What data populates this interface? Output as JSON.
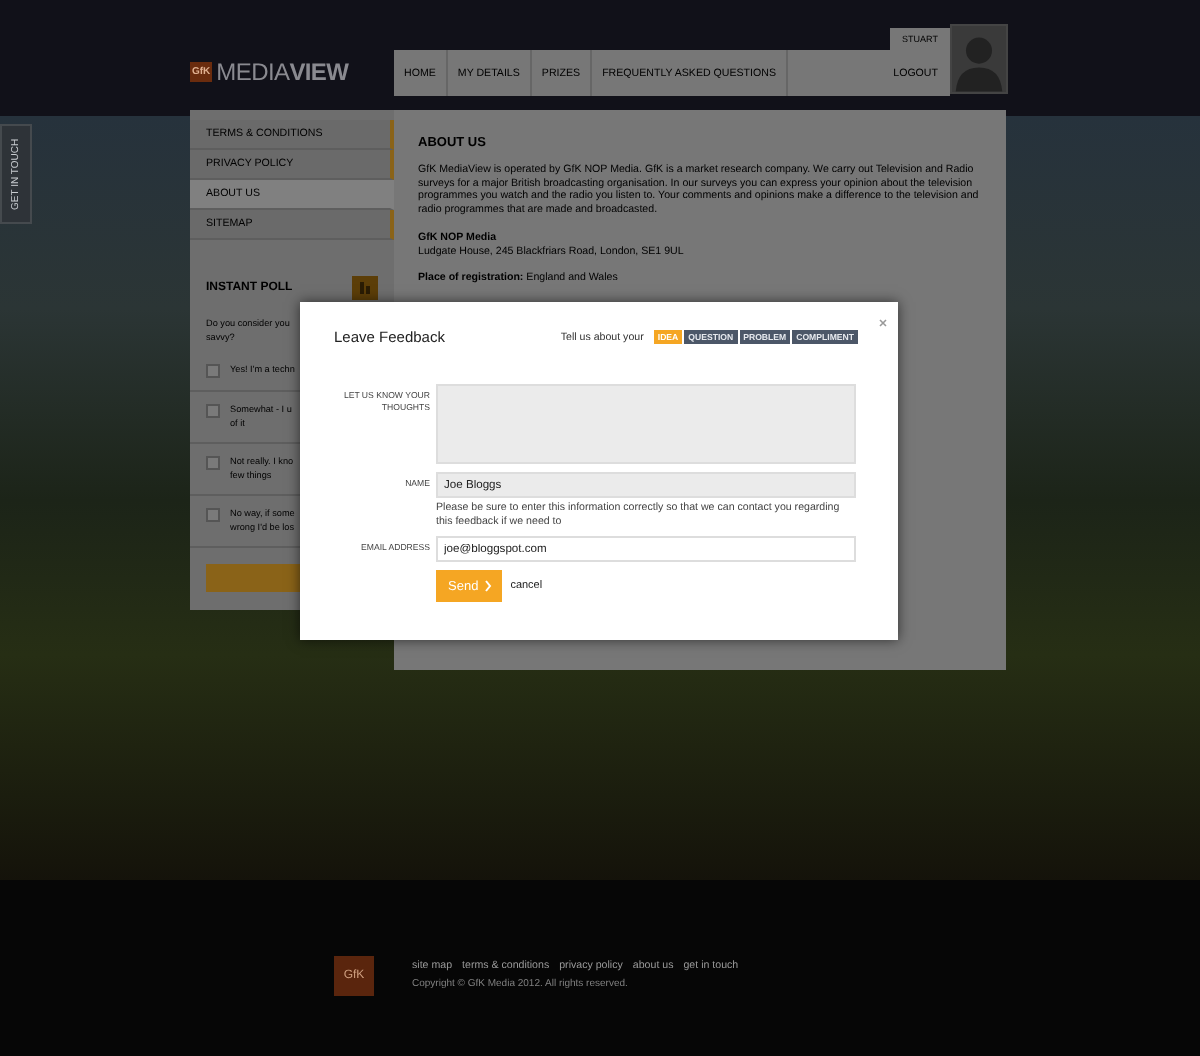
{
  "header": {
    "logo": {
      "mark": "GfK",
      "name_light": "MEDIA",
      "name_bold": "VIEW"
    },
    "nav": [
      {
        "label": "HOME"
      },
      {
        "label": "MY DETAILS"
      },
      {
        "label": "PRIZES"
      },
      {
        "label": "FREQUENTLY ASKED QUESTIONS"
      }
    ],
    "logout": "LOGOUT",
    "user": {
      "name": "STUART"
    }
  },
  "side_tab": {
    "label": "GET IN TOUCH"
  },
  "sidebar": {
    "items": [
      {
        "label": "TERMS & CONDITIONS",
        "selected": false
      },
      {
        "label": "PRIVACY POLICY",
        "selected": false
      },
      {
        "label": "ABOUT US",
        "selected": true
      },
      {
        "label": "SITEMAP",
        "selected": false
      }
    ],
    "poll": {
      "title": "INSTANT POLL",
      "question": [
        "Do you consider you",
        "savvy?"
      ],
      "options": [
        {
          "lines": [
            "Yes! I'm a techn"
          ],
          "checked": false
        },
        {
          "lines": [
            "Somewhat - I u",
            "of it"
          ],
          "checked": false
        },
        {
          "lines": [
            "Not really. I kno",
            "few things"
          ],
          "checked": false
        },
        {
          "lines": [
            "No way, if some",
            "wrong I'd be los"
          ],
          "checked": false
        }
      ]
    }
  },
  "content": {
    "title": "ABOUT US",
    "paragraph": "GfK MediaView is operated by GfK NOP Media. GfK is a market research company.  We carry out Television and Radio surveys for a major British broadcasting organisation. In our surveys you can express your opinion about the television programmes you watch and the radio you listen to. Your comments and opinions make a difference to the television and radio programmes that are made and broadcasted.",
    "company": "GfK NOP Media",
    "address": "Ludgate House, 245 Blackfriars Road, London, SE1 9UL",
    "registration": "**Place of registration:** England and Wales"
  },
  "modal": {
    "title": "Leave Feedback",
    "prompt": "Tell us about your",
    "types": [
      {
        "label": "IDEA",
        "selected": true
      },
      {
        "label": "QUESTION",
        "selected": false
      },
      {
        "label": "PROBLEM",
        "selected": false
      },
      {
        "label": "COMPLIMENT",
        "selected": false
      }
    ],
    "fields": [
      {
        "kind": "textarea",
        "label": "LET US KNOW YOUR THOUGHTS",
        "readonly": true
      },
      {
        "kind": "text",
        "label": "NAME",
        "value": "Joe Bloggs",
        "readonly": true,
        "help": "Please be sure to enter this information correctly so that we can contact you regarding this feedback if we need to"
      },
      {
        "kind": "text",
        "label": "EMAIL ADDRESS",
        "value": "joe@bloggspot.com",
        "readonly": false
      }
    ],
    "send": "Send",
    "cancel": "cancel"
  },
  "footer": {
    "logo": "GfK",
    "links": [
      "site map",
      "terms & conditions",
      "privacy policy",
      "about us",
      "get in touch"
    ],
    "copyright": "Copyright © GfK Media 2012. All rights reserved."
  }
}
